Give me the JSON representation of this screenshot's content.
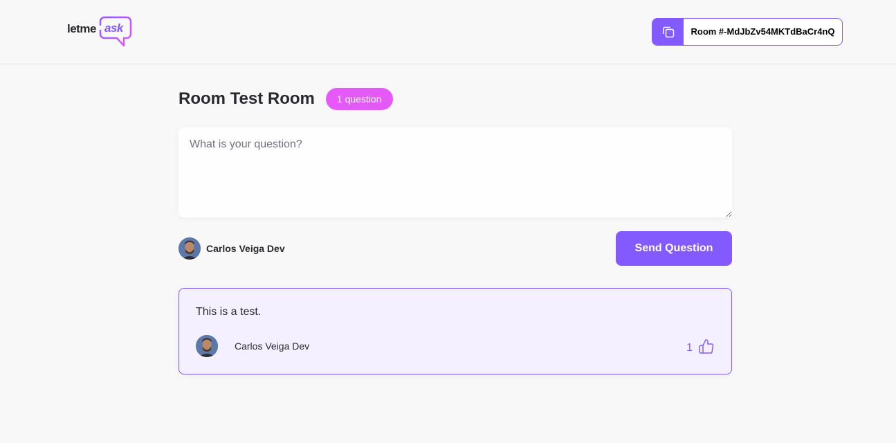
{
  "header": {
    "logo": {
      "part1": "letme",
      "part2": "ask"
    },
    "room_code": {
      "label": "Room #-MdJbZv54MKTdBaCr4nQ",
      "icon": "copy-icon"
    }
  },
  "room": {
    "title": "Room Test Room",
    "question_count": "1 question"
  },
  "form": {
    "placeholder": "What is your question?",
    "value": "",
    "user_name": "Carlos Veiga Dev",
    "submit_label": "Send Question"
  },
  "questions": [
    {
      "content": "This is a test.",
      "author": "Carlos Veiga Dev",
      "likes": "1",
      "like_icon": "thumbs-up-icon"
    }
  ],
  "colors": {
    "primary": "#835afd",
    "badge": "#e559f9",
    "background": "#f8f8f8",
    "highlight": "#f4f0ff"
  }
}
